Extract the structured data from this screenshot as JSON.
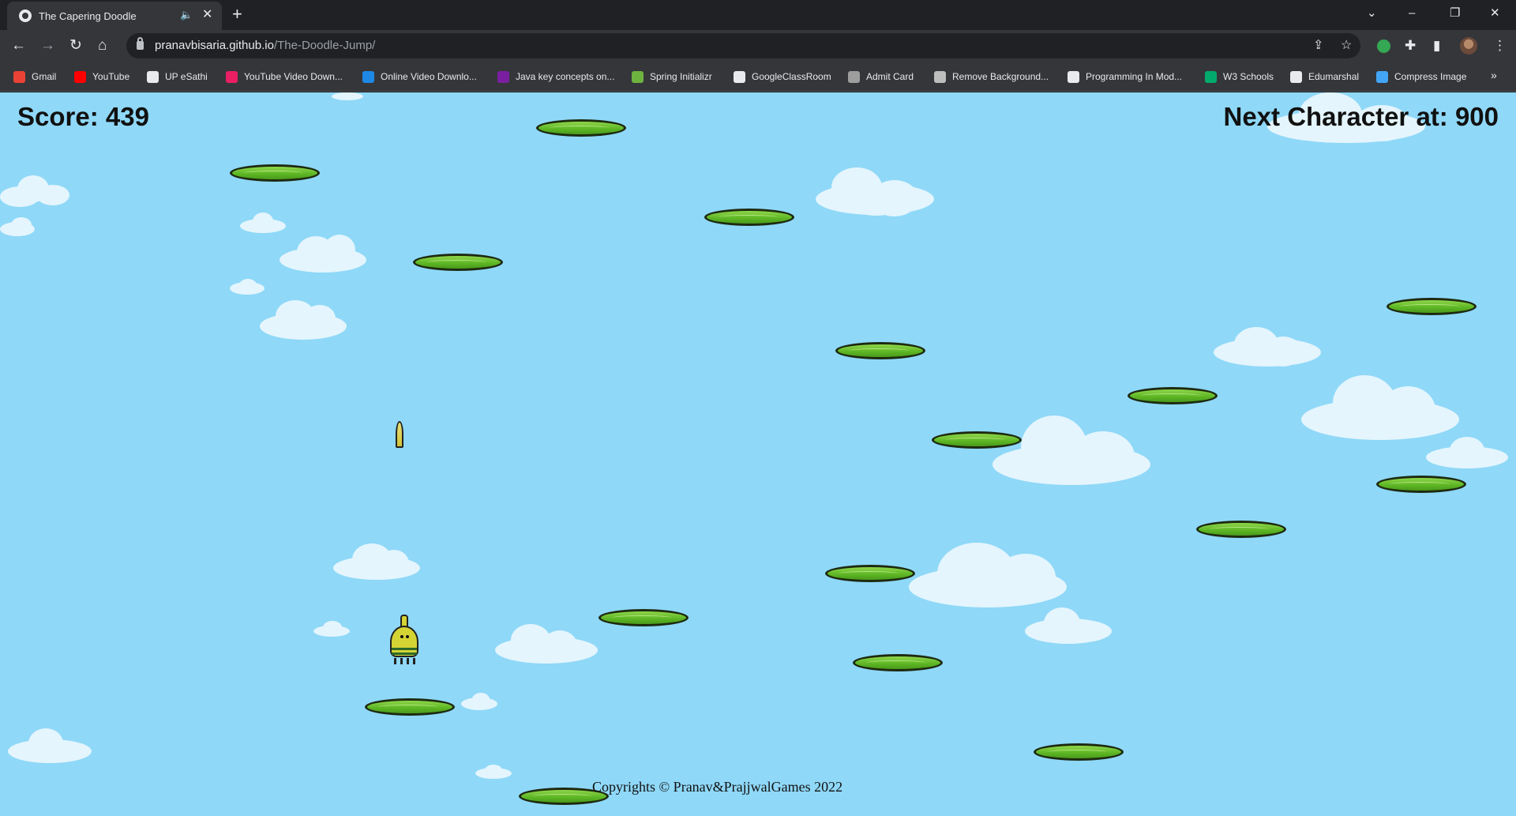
{
  "browser": {
    "tab_title": "The Capering Doodle",
    "tab_audio_icon": "speaker-icon",
    "tab_close": "✕",
    "new_tab": "+",
    "url_host": "pranavbisaria.github.io",
    "url_path": "/The-Doodle-Jump/",
    "window_controls": {
      "tab_search": "⌄",
      "minimize": "–",
      "restore": "❐",
      "close": "✕"
    },
    "nav": {
      "back": "←",
      "forward": "→",
      "reload": "↻",
      "home": "⌂"
    },
    "toolbar_icons": {
      "share": "⇪",
      "star": "☆",
      "extensions": "✚",
      "side_panel": "▮",
      "menu": "⋮"
    }
  },
  "bookmarks": [
    {
      "label": "Gmail",
      "color": "#ea4335"
    },
    {
      "label": "YouTube",
      "color": "#ff0000"
    },
    {
      "label": "UP eSathi",
      "color": "#e8eaed"
    },
    {
      "label": "YouTube Video Down...",
      "color": "#e91e63"
    },
    {
      "label": "Online Video Downlo...",
      "color": "#1e88e5"
    },
    {
      "label": "Java key concepts on...",
      "color": "#7b1fa2"
    },
    {
      "label": "Spring Initializr",
      "color": "#6db33f"
    },
    {
      "label": "GoogleClassRoom",
      "color": "#e8eaed"
    },
    {
      "label": "Admit Card",
      "color": "#9e9e9e"
    },
    {
      "label": "Remove Background...",
      "color": "#bdbdbd"
    },
    {
      "label": "Programming In Mod...",
      "color": "#e8eaed"
    },
    {
      "label": "W3 Schools",
      "color": "#04aa6d"
    },
    {
      "label": "Edumarshal",
      "color": "#e8eaed"
    },
    {
      "label": "Compress Image",
      "color": "#42a5f5"
    }
  ],
  "bookmarks_more": "»",
  "game": {
    "score_text": "Score: 439",
    "next_character_text": "Next Character at: 900",
    "footer": "Copyrights © Pranav&PrajjwalGames 2022",
    "colors": {
      "sky": "#8fd8f8",
      "platform": "#5cb523",
      "cloud": "#e4f5fd",
      "doodler": "#d4d434"
    }
  }
}
